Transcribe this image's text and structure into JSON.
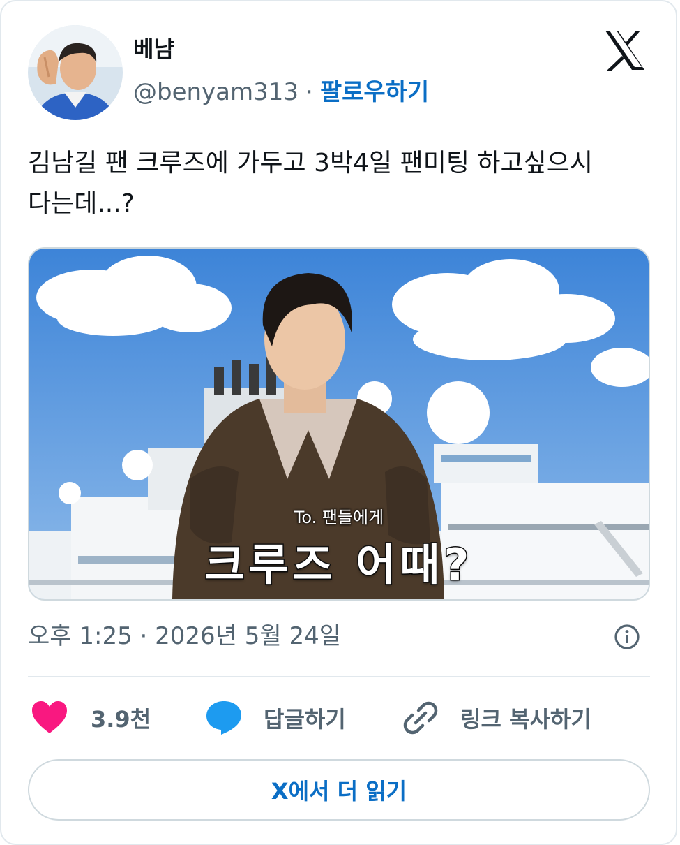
{
  "author": {
    "display_name": "베냠",
    "handle": "@benyam313",
    "separator": "·",
    "follow_label": "팔로우하기",
    "avatar_icon": "user-avatar"
  },
  "brand_icon": "x-logo-icon",
  "tweet": {
    "text_line1": "김남길 팬 크루즈에 가두고 3박4일 팬미팅 하고싶으시",
    "text_line2": "다는데...?"
  },
  "media": {
    "subtitle_small": "To. 팬들에게",
    "subtitle_big": "크루즈 어때?"
  },
  "meta": {
    "timestamp": "오후 1:25 · 2026년 5월 24일",
    "info_icon": "info-icon"
  },
  "actions": {
    "like_count": "3.9천",
    "reply_label": "답글하기",
    "copy_link_label": "링크 복사하기"
  },
  "read_more_label": "X에서 더 읽기",
  "colors": {
    "accent": "#0b6ec5",
    "like": "#f91880",
    "reply": "#1d9bf0",
    "secondary_text": "#536471",
    "border": "#cfd9de"
  }
}
